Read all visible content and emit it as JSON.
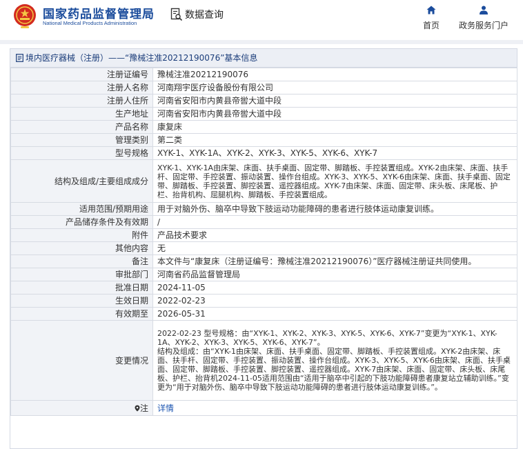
{
  "header": {
    "logo_cn": "国家药品监督管理局",
    "logo_en": "National Medical Products Administration",
    "data_query": "数据查询",
    "nav": [
      {
        "label": "首页",
        "icon": "home-icon"
      },
      {
        "label": "政务服务门户",
        "icon": "user-icon"
      }
    ]
  },
  "panel": {
    "title": "境内医疗器械（注册）——“豫械注准20212190076”基本信息",
    "rows": [
      {
        "key": "注册证编号",
        "value": "豫械注准20212190076"
      },
      {
        "key": "注册人名称",
        "value": "河南翔宇医疗设备股份有限公司"
      },
      {
        "key": "注册人住所",
        "value": "河南省安阳市内黄县帝喾大道中段"
      },
      {
        "key": "生产地址",
        "value": "河南省安阳市内黄县帝喾大道中段"
      },
      {
        "key": "产品名称",
        "value": "康复床"
      },
      {
        "key": "管理类别",
        "value": "第二类"
      },
      {
        "key": "型号规格",
        "value": "XYK-1、XYK-1A、XYK-2、XYK-3、XYK-5、XYK-6、XYK-7"
      },
      {
        "key": "结构及组成/主要组成成分",
        "value": "XYK-1、XYK-1A由床架、床面、扶手桌面、固定带、脚踏板、手控装置组成。XYK-2由床架、床面、扶手杆、固定带、手控装置、振动装置、操作台组成。XYK-3、XYK-5、XYK-6由床架、床面、扶手桌面、固定带、脚踏板、手控装置、脚控装置、遥控器组成。XYK-7由床架、床面、固定带、床头板、床尾板、护栏、抬背机构、屈腿机构、脚踏板、手控装置组成。"
      },
      {
        "key": "适用范围/预期用途",
        "value": "用于对脑外伤、脑卒中导致下肢运动功能障碍的患者进行肢体运动康复训练。"
      },
      {
        "key": "产品储存条件及有效期",
        "value": "/"
      },
      {
        "key": "附件",
        "value": "产品技术要求"
      },
      {
        "key": "其他内容",
        "value": "无"
      },
      {
        "key": "备注",
        "value": "本文件与“康复床（注册证编号：豫械注准20212190076）”医疗器械注册证共同使用。"
      },
      {
        "key": "审批部门",
        "value": "河南省药品监督管理局"
      },
      {
        "key": "批准日期",
        "value": "2024-11-05"
      },
      {
        "key": "生效日期",
        "value": "2022-02-23"
      },
      {
        "key": "有效期至",
        "value": "2026-05-31"
      },
      {
        "key": "变更情况",
        "value": "2022-02-23 型号规格：由“XYK-1、XYK-2、XYK-3、XYK-5、XYK-6、XYK-7”变更为“XYK-1、XYK-1A、XYK-2、XYK-3、XYK-5、XYK-6、XYK-7”。",
        "value2": "结构及组成：由“XYK-1由床架、床面、扶手桌面、固定带、脚踏板、手控装置组成。XYK-2由床架、床面、扶手杆、固定带、手控装置、振动装置、操作台组成。XYK-3、XYK-5、XYK-6由床架、床面、扶手桌面、固定带、脚踏板、手控装置、脚控装置、遥控器组成。XYK-7由床架、床面、固定带、床头板、床尾板、护栏、抬背机2024-11-05适用范围由“适用于脑卒中引起的下肢功能障碍患者康复站立辅助训练。”变更为“用于对脑外伤、脑卒中导致下肢运动功能障碍的患者进行肢体运动康复训练。”。"
      },
      {
        "key": "注",
        "value": "详情"
      }
    ]
  }
}
